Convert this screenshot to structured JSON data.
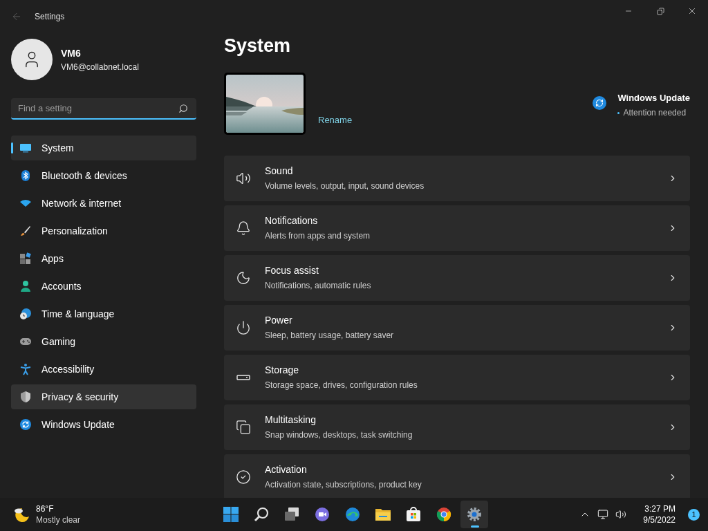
{
  "window": {
    "title": "Settings",
    "back_disabled": true
  },
  "profile": {
    "name": "VM6",
    "email": "VM6@collabnet.local"
  },
  "search": {
    "placeholder": "Find a setting"
  },
  "sidebar": {
    "items": [
      {
        "label": "System",
        "selected": true,
        "hovered": false
      },
      {
        "label": "Bluetooth & devices",
        "selected": false,
        "hovered": false
      },
      {
        "label": "Network & internet",
        "selected": false,
        "hovered": false
      },
      {
        "label": "Personalization",
        "selected": false,
        "hovered": false
      },
      {
        "label": "Apps",
        "selected": false,
        "hovered": false
      },
      {
        "label": "Accounts",
        "selected": false,
        "hovered": false
      },
      {
        "label": "Time & language",
        "selected": false,
        "hovered": false
      },
      {
        "label": "Gaming",
        "selected": false,
        "hovered": false
      },
      {
        "label": "Accessibility",
        "selected": false,
        "hovered": false
      },
      {
        "label": "Privacy & security",
        "selected": false,
        "hovered": true
      },
      {
        "label": "Windows Update",
        "selected": false,
        "hovered": false
      }
    ]
  },
  "page": {
    "title": "System",
    "device": {
      "kind": "picture",
      "rename": "Rename"
    },
    "update": {
      "title": "Windows Update",
      "status": "Attention needed"
    },
    "cards": [
      {
        "title": "Sound",
        "subtitle": "Volume levels, output, input, sound devices"
      },
      {
        "title": "Notifications",
        "subtitle": "Alerts from apps and system"
      },
      {
        "title": "Focus assist",
        "subtitle": "Notifications, automatic rules"
      },
      {
        "title": "Power",
        "subtitle": "Sleep, battery usage, battery saver"
      },
      {
        "title": "Storage",
        "subtitle": "Storage space, drives, configuration rules"
      },
      {
        "title": "Multitasking",
        "subtitle": "Snap windows, desktops, task switching"
      },
      {
        "title": "Activation",
        "subtitle": "Activation state, subscriptions, product key"
      }
    ]
  },
  "taskbar": {
    "weather": {
      "temperature": "86°F",
      "condition": "Mostly clear"
    },
    "apps": [
      {
        "active": false
      },
      {
        "active": false
      },
      {
        "active": false
      },
      {
        "active": false
      },
      {
        "active": false
      },
      {
        "active": false
      },
      {
        "active": false
      },
      {
        "active": false
      },
      {
        "active": true
      }
    ],
    "clock": {
      "time": "3:27 PM",
      "date": "9/5/2022"
    },
    "notifications": "1"
  }
}
